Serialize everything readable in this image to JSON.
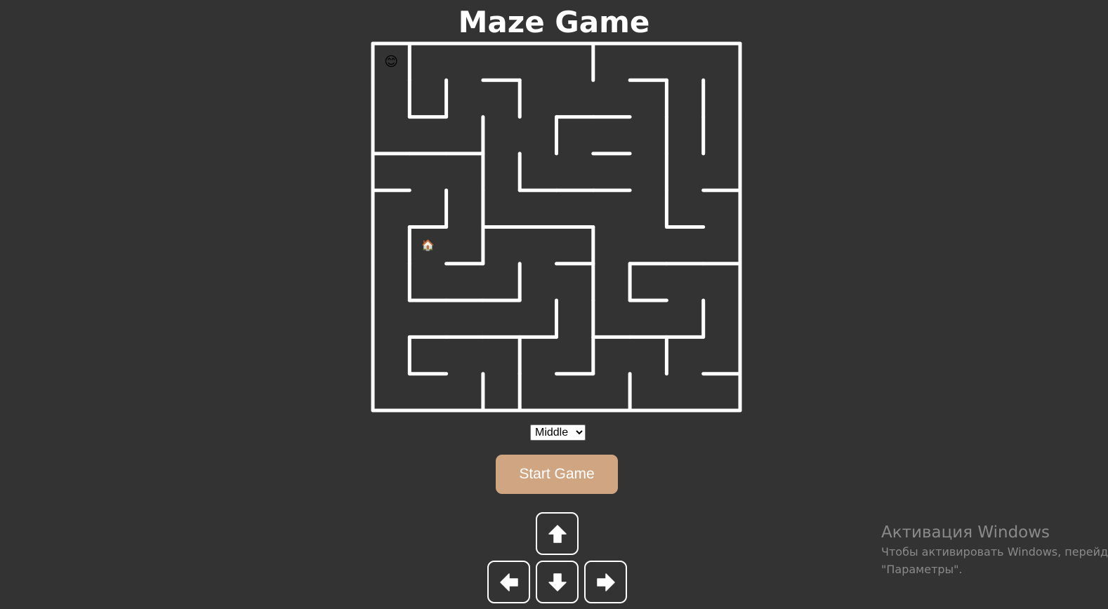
{
  "title": "Maze Game",
  "maze": {
    "rows": 10,
    "cols": 10,
    "player": {
      "row": 0,
      "col": 0,
      "icon": "😊"
    },
    "goal": {
      "row": 5,
      "col": 1,
      "icon": "🏠"
    },
    "wall_color": "#ffffff",
    "walls": {
      "horizontal": [
        [
          1,
          1,
          1,
          1,
          1,
          1,
          1,
          1,
          1,
          1
        ],
        [
          0,
          0,
          0,
          1,
          0,
          0,
          0,
          1,
          0,
          0
        ],
        [
          0,
          1,
          0,
          0,
          0,
          1,
          1,
          0,
          0,
          0
        ],
        [
          1,
          1,
          1,
          0,
          0,
          0,
          1,
          0,
          0,
          0
        ],
        [
          1,
          0,
          0,
          0,
          1,
          1,
          1,
          0,
          0,
          1
        ],
        [
          0,
          1,
          0,
          1,
          1,
          1,
          0,
          0,
          1,
          0
        ],
        [
          0,
          0,
          1,
          0,
          0,
          1,
          0,
          1,
          1,
          1
        ],
        [
          0,
          1,
          1,
          1,
          0,
          0,
          0,
          1,
          0,
          0
        ],
        [
          0,
          1,
          1,
          1,
          1,
          0,
          1,
          1,
          1,
          0
        ],
        [
          0,
          1,
          0,
          0,
          0,
          1,
          0,
          0,
          0,
          1
        ],
        [
          1,
          1,
          1,
          1,
          1,
          1,
          1,
          1,
          1,
          1
        ]
      ],
      "vertical": [
        [
          1,
          1,
          0,
          0,
          0,
          0,
          1,
          0,
          0,
          0,
          1
        ],
        [
          1,
          1,
          1,
          0,
          1,
          0,
          0,
          0,
          1,
          1,
          1
        ],
        [
          1,
          0,
          0,
          1,
          0,
          1,
          0,
          0,
          1,
          1,
          1
        ],
        [
          1,
          0,
          0,
          1,
          1,
          0,
          0,
          0,
          1,
          0,
          1
        ],
        [
          1,
          0,
          1,
          1,
          0,
          0,
          0,
          0,
          1,
          0,
          1
        ],
        [
          1,
          1,
          0,
          1,
          0,
          0,
          1,
          0,
          0,
          0,
          1
        ],
        [
          1,
          1,
          0,
          0,
          1,
          0,
          1,
          1,
          0,
          0,
          1
        ],
        [
          1,
          0,
          0,
          0,
          0,
          1,
          1,
          0,
          0,
          1,
          1
        ],
        [
          1,
          1,
          0,
          0,
          1,
          0,
          1,
          0,
          1,
          0,
          1
        ],
        [
          1,
          0,
          0,
          1,
          1,
          0,
          0,
          1,
          0,
          0,
          1
        ]
      ]
    }
  },
  "difficulty": {
    "selected": "Middle",
    "options": [
      "Middle"
    ]
  },
  "start_button_label": "Start Game",
  "controls": {
    "up": "arrow-up-icon",
    "left": "arrow-left-icon",
    "down": "arrow-down-icon",
    "right": "arrow-right-icon"
  },
  "colors": {
    "background": "#333333",
    "accent": "#d0a582",
    "text": "#ffffff"
  },
  "windows_activation": {
    "title": "Активация Windows",
    "line1": "Чтобы активировать Windows, перейди",
    "line2": "\"Параметры\"."
  }
}
